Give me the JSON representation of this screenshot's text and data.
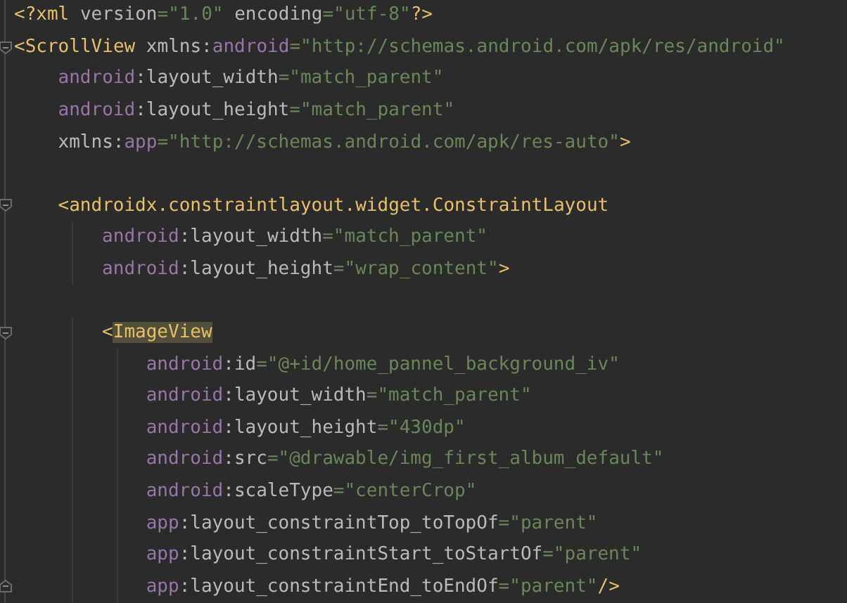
{
  "editor": {
    "lines": [
      {
        "kind": "code",
        "tokens": [
          {
            "kind": "tag",
            "text": "<?xml "
          },
          {
            "kind": "name",
            "text": "version"
          },
          {
            "kind": "value",
            "text": "=\"1.0\" "
          },
          {
            "kind": "name",
            "text": "encoding"
          },
          {
            "kind": "value",
            "text": "=\"utf-8\""
          },
          {
            "kind": "tag",
            "text": "?>"
          }
        ]
      },
      {
        "kind": "code",
        "fold_start": true,
        "tokens": [
          {
            "kind": "tag",
            "text": "<ScrollView "
          },
          {
            "kind": "plain",
            "text": "xmlns:"
          },
          {
            "kind": "ns",
            "text": "android"
          },
          {
            "kind": "value",
            "text": "=\"http://schemas.android.com/apk/res/android\""
          }
        ]
      },
      {
        "kind": "code",
        "tokens": [
          {
            "kind": "ns",
            "text": "    android"
          },
          {
            "kind": "plain",
            "text": ":layout_width"
          },
          {
            "kind": "value",
            "text": "=\"match_parent\""
          }
        ]
      },
      {
        "kind": "code",
        "tokens": [
          {
            "kind": "ns",
            "text": "    android"
          },
          {
            "kind": "plain",
            "text": ":layout_height"
          },
          {
            "kind": "value",
            "text": "=\"match_parent\""
          }
        ]
      },
      {
        "kind": "code",
        "tokens": [
          {
            "kind": "plain",
            "text": "    xmlns:"
          },
          {
            "kind": "ns",
            "text": "app"
          },
          {
            "kind": "value",
            "text": "=\"http://schemas.android.com/apk/res-auto\""
          },
          {
            "kind": "tag",
            "text": ">"
          }
        ]
      },
      {
        "kind": "blank"
      },
      {
        "kind": "code",
        "fold_start": true,
        "tokens": [
          {
            "kind": "tag",
            "text": "    <androidx.constraintlayout.widget.ConstraintLayout"
          }
        ]
      },
      {
        "kind": "code",
        "tokens": [
          {
            "kind": "ns",
            "text": "        android"
          },
          {
            "kind": "plain",
            "text": ":layout_width"
          },
          {
            "kind": "value",
            "text": "=\"match_parent\""
          }
        ]
      },
      {
        "kind": "code",
        "tokens": [
          {
            "kind": "ns",
            "text": "        android"
          },
          {
            "kind": "plain",
            "text": ":layout_height"
          },
          {
            "kind": "value",
            "text": "=\"wrap_content\""
          },
          {
            "kind": "tag",
            "text": ">"
          }
        ]
      },
      {
        "kind": "blank"
      },
      {
        "kind": "code",
        "fold_start": true,
        "tokens": [
          {
            "kind": "tag",
            "text": "        <"
          },
          {
            "kind": "tag",
            "text": "ImageView",
            "highlight": true
          }
        ]
      },
      {
        "kind": "code",
        "tokens": [
          {
            "kind": "ns",
            "text": "            android"
          },
          {
            "kind": "plain",
            "text": ":id"
          },
          {
            "kind": "value",
            "text": "=\"@+id/home_pannel_background_iv\""
          }
        ]
      },
      {
        "kind": "code",
        "tokens": [
          {
            "kind": "ns",
            "text": "            android"
          },
          {
            "kind": "plain",
            "text": ":layout_width"
          },
          {
            "kind": "value",
            "text": "=\"match_parent\""
          }
        ]
      },
      {
        "kind": "code",
        "tokens": [
          {
            "kind": "ns",
            "text": "            android"
          },
          {
            "kind": "plain",
            "text": ":layout_height"
          },
          {
            "kind": "value",
            "text": "=\"430dp\""
          }
        ]
      },
      {
        "kind": "code",
        "tokens": [
          {
            "kind": "ns",
            "text": "            android"
          },
          {
            "kind": "plain",
            "text": ":src"
          },
          {
            "kind": "value",
            "text": "=\"@drawable/img_first_album_default\""
          }
        ]
      },
      {
        "kind": "code",
        "tokens": [
          {
            "kind": "ns",
            "text": "            android"
          },
          {
            "kind": "plain",
            "text": ":scaleType"
          },
          {
            "kind": "value",
            "text": "=\"centerCrop\""
          }
        ]
      },
      {
        "kind": "code",
        "tokens": [
          {
            "kind": "ns",
            "text": "            app"
          },
          {
            "kind": "plain",
            "text": ":layout_constraintTop_toTopOf"
          },
          {
            "kind": "value",
            "text": "=\"parent\""
          }
        ]
      },
      {
        "kind": "code",
        "tokens": [
          {
            "kind": "ns",
            "text": "            app"
          },
          {
            "kind": "plain",
            "text": ":layout_constraintStart_toStartOf"
          },
          {
            "kind": "value",
            "text": "=\"parent\""
          }
        ]
      },
      {
        "kind": "code",
        "fold_end": true,
        "tokens": [
          {
            "kind": "ns",
            "text": "            app"
          },
          {
            "kind": "plain",
            "text": ":layout_constraintEnd_toEndOf"
          },
          {
            "kind": "value",
            "text": "=\"parent\""
          },
          {
            "kind": "tag",
            "text": "/>"
          }
        ]
      }
    ]
  }
}
